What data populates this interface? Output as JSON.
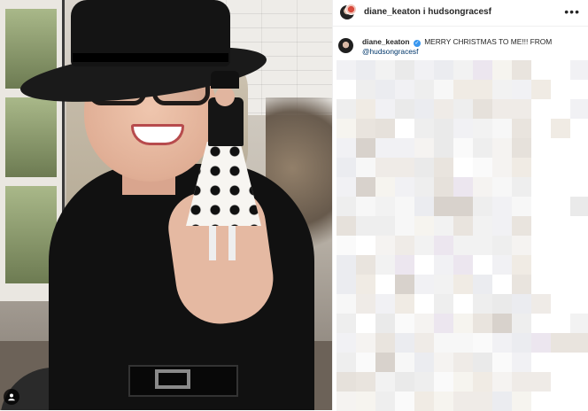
{
  "post": {
    "header": {
      "title": "diane_keaton i hudsongracesf",
      "more_icon": "more-options-icon"
    },
    "caption": {
      "username": "diane_keaton",
      "verified_icon": "verified-badge-icon",
      "text": "MERRY CHRISTMAS TO ME!!! FROM",
      "mention": "@hudsongracesf"
    },
    "media": {
      "user_tag_icon": "user-tag-icon"
    },
    "comments_censored": true
  },
  "colors": {
    "text": "#262626",
    "mention": "#00376b",
    "verified": "#3897f0",
    "border": "#efefef"
  }
}
